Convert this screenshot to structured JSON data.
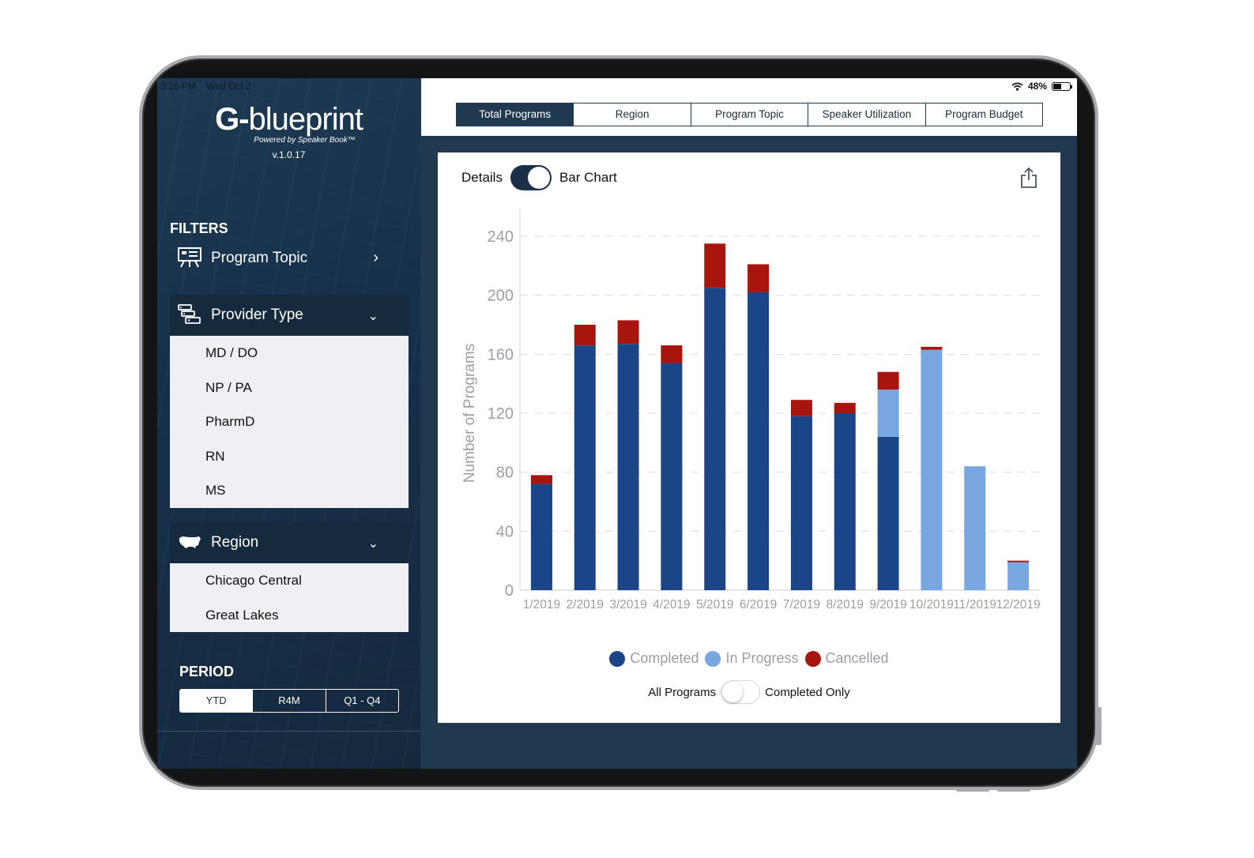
{
  "status_bar": {
    "time": "3:16 PM",
    "date": "Wed Oct 2",
    "battery": "48%",
    "battery_level": 0.48
  },
  "sidebar": {
    "logo": {
      "bold": "G-",
      "light": "blueprint",
      "tagline": "Powered by Speaker Book™",
      "version": "v.1.0.17"
    },
    "filters_title": "FILTERS",
    "program_topic": {
      "label": "Program Topic",
      "icon": "presentation-icon"
    },
    "provider_type": {
      "label": "Provider Type",
      "icon": "server-list-icon",
      "options": [
        "MD / DO",
        "NP / PA",
        "PharmD",
        "RN",
        "MS"
      ]
    },
    "region": {
      "label": "Region",
      "icon": "usa-map-icon",
      "options": [
        "Chicago Central",
        "Great Lakes"
      ]
    },
    "period": {
      "title": "PERIOD",
      "options": [
        "YTD",
        "R4M",
        "Q1 - Q4"
      ],
      "selected": "YTD"
    }
  },
  "tabs": [
    "Total Programs",
    "Region",
    "Program Topic",
    "Speaker Utilization",
    "Program Budget"
  ],
  "active_tab": "Total Programs",
  "view_toggle": {
    "left": "Details",
    "right": "Bar Chart",
    "on": true
  },
  "filter_toggle": {
    "left": "All Programs",
    "right": "Completed Only",
    "on": false
  },
  "colors": {
    "completed": "#1c4587",
    "in_progress": "#77a6e0",
    "cancelled": "#a8150c",
    "navy": "#20394e"
  },
  "chart_data": {
    "type": "bar",
    "stacked": true,
    "ylabel": "Number of Programs",
    "ylim": [
      0,
      240
    ],
    "yticks": [
      0,
      40,
      80,
      120,
      160,
      200,
      240
    ],
    "grid": true,
    "legend": "bottom",
    "categories": [
      "1/2019",
      "2/2019",
      "3/2019",
      "4/2019",
      "5/2019",
      "6/2019",
      "7/2019",
      "8/2019",
      "9/2019",
      "10/2019",
      "11/2019",
      "12/2019"
    ],
    "series": [
      {
        "name": "Completed",
        "values": [
          72,
          166,
          167,
          154,
          205,
          202,
          118,
          120,
          104,
          0,
          0,
          0
        ]
      },
      {
        "name": "In Progress",
        "values": [
          0,
          0,
          0,
          0,
          0,
          0,
          0,
          0,
          32,
          163,
          84,
          19
        ]
      },
      {
        "name": "Cancelled",
        "values": [
          6,
          14,
          16,
          12,
          30,
          19,
          11,
          7,
          12,
          2,
          0,
          1
        ]
      }
    ]
  }
}
